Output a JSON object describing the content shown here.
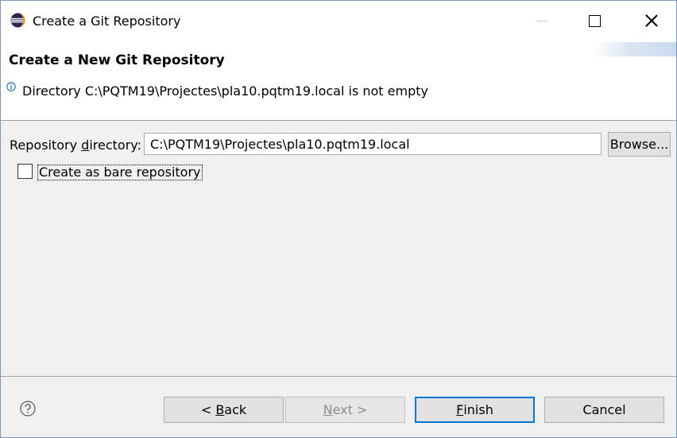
{
  "window": {
    "title": "Create a Git Repository"
  },
  "header": {
    "page_title": "Create a New Git Repository",
    "message": "Directory C:\\PQTM19\\Projectes\\pla10.pqtm19.local is not empty"
  },
  "form": {
    "repository_directory": {
      "label_prefix": "Repository ",
      "label_mnemonic": "d",
      "label_suffix": "irectory:",
      "value": "C:\\PQTM19\\Projectes\\pla10.pqtm19.local"
    },
    "browse_label": "Browse...",
    "bare_repository": {
      "label": "Create as bare repository",
      "checked": false
    }
  },
  "buttons": {
    "back": {
      "prefix": "< ",
      "mnemonic": "B",
      "rest": "ack"
    },
    "next": {
      "mnemonic": "N",
      "rest": "ext >"
    },
    "finish": {
      "mnemonic": "F",
      "rest": "inish"
    },
    "cancel": "Cancel"
  },
  "colors": {
    "accent": "#0078d7",
    "info_icon": "#1e6fc1"
  },
  "icons": {
    "app": "eclipse-icon",
    "info": "info-icon",
    "help": "help-icon"
  }
}
